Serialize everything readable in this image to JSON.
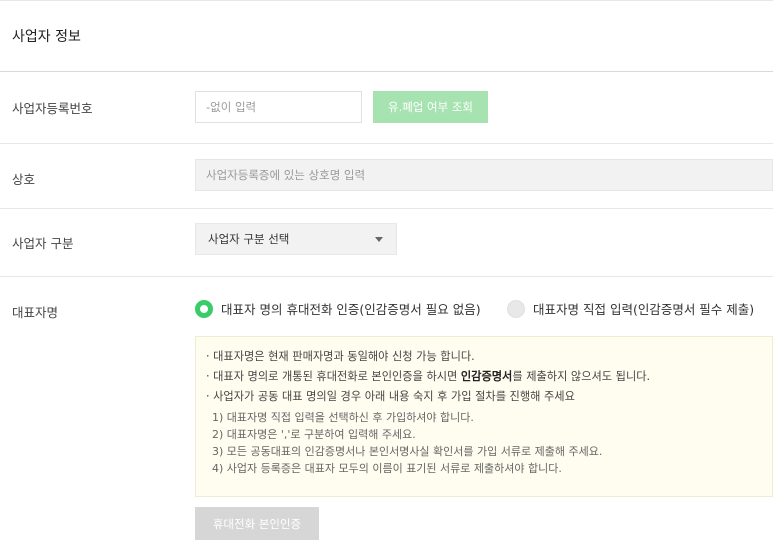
{
  "section": {
    "title": "사업자 정보"
  },
  "business_number": {
    "label": "사업자등록번호",
    "placeholder": "-없이 입력",
    "check_button": "유.폐업 여부 조회"
  },
  "company_name": {
    "label": "상호",
    "placeholder": "사업자등록증에 있는 상호명 입력"
  },
  "business_type": {
    "label": "사업자 구분",
    "selected": "사업자 구분 선택"
  },
  "representative": {
    "label": "대표자명",
    "options": [
      {
        "label": "대표자 명의 휴대전화 인증(인감증명서 필요 없음)",
        "checked": true
      },
      {
        "label": "대표자명 직접 입력(인감증명서 필수 제출)",
        "checked": false
      }
    ],
    "notice": {
      "line1": "· 대표자명은 현재 판매자명과 동일해야 신청 가능 합니다.",
      "line2_pre": "· 대표자 명의로 개통된 휴대전화로 본인인증을 하시면 ",
      "line2_bold": "인감증명서",
      "line2_post": "를 제출하지 않으셔도 됩니다.",
      "line3": "· 사업자가 공동 대표 명의일 경우 아래 내용 숙지 후 가입 절차를 진행해 주세요",
      "steps": [
        "1) 대표자명 직접 입력을 선택하신 후 가입하셔야 합니다.",
        "2) 대표자명은 ','로 구분하여 입력해 주세요.",
        "3) 모든 공동대표의 인감증명서나 본인서명사실 확인서를 가입 서류로 제출해 주세요.",
        "4) 사업자 등록증은 대표자 모두의 이름이 표기된 서류로 제출하셔야 합니다."
      ]
    },
    "verify_button": "휴대전화 본인인증"
  },
  "colors": {
    "accent_green": "#3bcc6a",
    "button_green": "#a6e3b0",
    "notice_bg": "#fffdf0",
    "disabled_gray": "#d6d6d6"
  }
}
